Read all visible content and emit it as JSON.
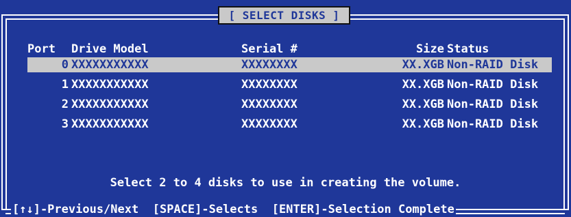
{
  "title": "[ SELECT DISKS ]",
  "columns": {
    "port": "Port",
    "model": "Drive Model",
    "serial": "Serial #",
    "size": "Size",
    "status": "Status"
  },
  "disks": [
    {
      "port": "0",
      "model": "XXXXXXXXXXX",
      "serial": "XXXXXXXX",
      "size": "XX.XGB",
      "status": "Non-RAID Disk",
      "selected": true
    },
    {
      "port": "1",
      "model": "XXXXXXXXXXX",
      "serial": "XXXXXXXX",
      "size": "XX.XGB",
      "status": "Non-RAID Disk",
      "selected": false
    },
    {
      "port": "2",
      "model": "XXXXXXXXXXX",
      "serial": "XXXXXXXX",
      "size": "XX.XGB",
      "status": "Non-RAID Disk",
      "selected": false
    },
    {
      "port": "3",
      "model": "XXXXXXXXXXX",
      "serial": "XXXXXXXX",
      "size": "XX.XGB",
      "status": "Non-RAID Disk",
      "selected": false
    }
  ],
  "message": "Select 2 to 4 disks to use in creating the volume.",
  "footer": {
    "nav": "[↑↓]-Previous/Next",
    "select": "[SPACE]-Selects",
    "complete": "[ENTER]-Selection Complete"
  },
  "colors": {
    "background": "#1f3799",
    "highlight": "#c9c9c9",
    "text": "#ffffff"
  }
}
